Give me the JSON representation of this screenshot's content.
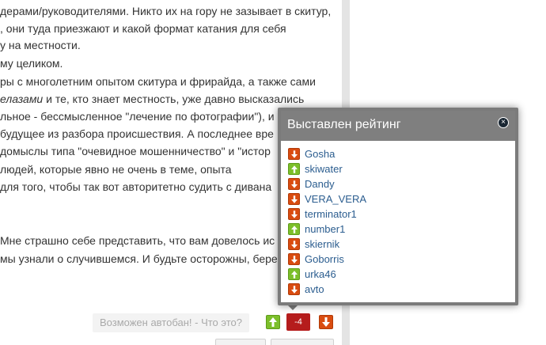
{
  "article": {
    "lines": [
      {
        "text": "дерами/руководителями. Никто их на гору не зазывает в скитур,"
      },
      {
        "text": ", они туда приезжают и какой формат катания для себя"
      },
      {
        "text": "у на местности."
      },
      {
        "text": "му целиком."
      },
      {
        "text": "ры с многолетним опытом скитура и фрирайда, а также сами"
      },
      {
        "text_em": "елазами",
        "text": " и те, кто знает местность, уже давно высказались"
      },
      {
        "text": "льное - бессмысленное \"лечение по фотографии\"), и"
      },
      {
        "text": " будущее из разбора происшествия. А последнее вре"
      },
      {
        "text": "домыслы типа \"очевидное мошенничество\" и \"истор"
      },
      {
        "text": " людей, которые явно не очень в теме, опыта"
      },
      {
        "text": "для того, чтобы так вот авторитетно судить с дивана"
      },
      {
        "text": ""
      },
      {
        "text": ""
      },
      {
        "text": "Мне страшно себе представить, что вам довелось ис"
      },
      {
        "text": "мы узнали о случившемся. И будьте осторожны, бере"
      }
    ]
  },
  "vote_bar": {
    "autoban_text": "Возможен автобан! - Что это?",
    "score": "-4"
  },
  "modal": {
    "title": "Выставлен рейтинг",
    "close_icon": "×",
    "items": [
      {
        "user": "Gosha",
        "vote": "down"
      },
      {
        "user": "skiwater",
        "vote": "up"
      },
      {
        "user": "Dandy",
        "vote": "down"
      },
      {
        "user": "VERA_VERA",
        "vote": "down"
      },
      {
        "user": "terminator1",
        "vote": "down"
      },
      {
        "user": "number1",
        "vote": "up"
      },
      {
        "user": "skiernik",
        "vote": "down"
      },
      {
        "user": "Goborris",
        "vote": "down"
      },
      {
        "user": "urka46",
        "vote": "up"
      },
      {
        "user": "avto",
        "vote": "down"
      }
    ]
  },
  "colors": {
    "vote_up": "#7cbf2a",
    "vote_down": "#d94c10",
    "score_badge": "#b51c1c",
    "username_link": "#2b5d8f",
    "modal_header": "#7f7f7f"
  }
}
